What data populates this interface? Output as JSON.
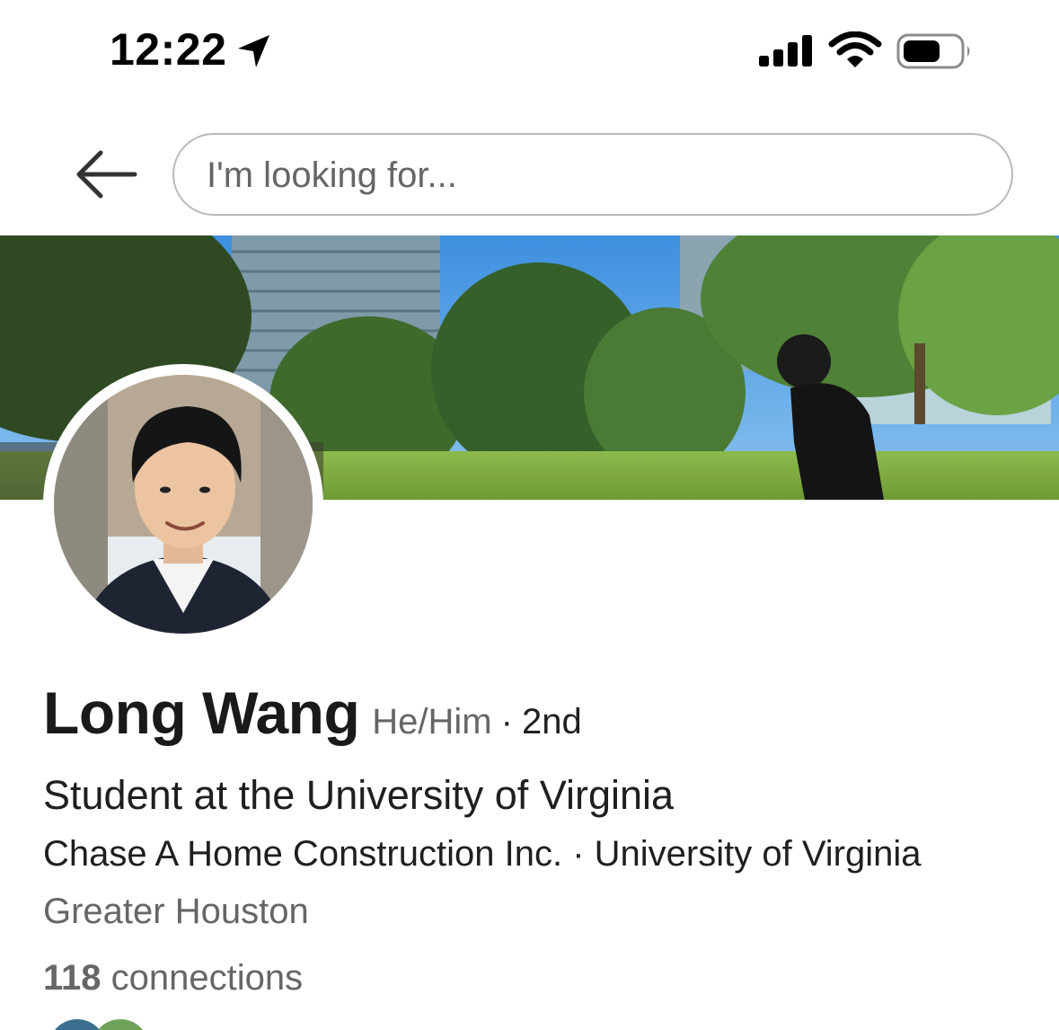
{
  "status_bar": {
    "time": "12:22",
    "icons": [
      "location-arrow-icon",
      "cellular-signal-icon",
      "wifi-icon",
      "battery-icon"
    ]
  },
  "header": {
    "back_icon": "back-arrow-icon",
    "search_placeholder": "I'm looking for..."
  },
  "profile": {
    "name": "Long Wang",
    "pronouns": "He/Him",
    "separator": "·",
    "degree": "2nd",
    "headline": "Student at the University of Virginia",
    "current_company": "Chase A Home Construction Inc.",
    "education": "University of Virginia",
    "location": "Greater Houston",
    "connections_count": "118",
    "connections_label": "connections"
  },
  "colors": {
    "text_primary": "#1a1a1a",
    "text_secondary": "#666666",
    "search_border": "#b9b9b9"
  }
}
